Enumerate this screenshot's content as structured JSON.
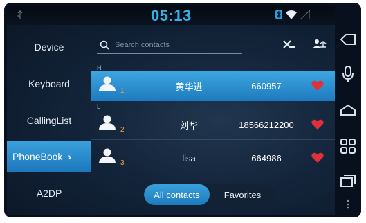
{
  "status": {
    "time": "05:13"
  },
  "sidebar": {
    "items": [
      {
        "label": "Device"
      },
      {
        "label": "Keyboard"
      },
      {
        "label": "CallingList"
      },
      {
        "label": "PhoneBook",
        "chevron": "›"
      },
      {
        "label": "A2DP"
      }
    ]
  },
  "search": {
    "placeholder": "Search contacts"
  },
  "contacts": [
    {
      "section": "H",
      "index": "1",
      "name": "黄华进",
      "phone": "660957"
    },
    {
      "section": "L",
      "index": "2",
      "name": "刘华",
      "phone": "18566212200"
    },
    {
      "section": "",
      "index": "3",
      "name": "lisa",
      "phone": "664986"
    }
  ],
  "tabs": {
    "all": "All contacts",
    "favorites": "Favorites"
  },
  "colors": {
    "accent": "#2a8fd0",
    "clock": "#36b0e8",
    "heart": "#e0303a",
    "index": "#f0a630"
  },
  "icons": [
    "search-icon",
    "clear-contacts-icon",
    "sync-contacts-icon",
    "avatar-icon",
    "heart-icon",
    "back-icon",
    "mic-icon",
    "home-icon",
    "apps-icon",
    "recents-icon",
    "bluetooth-icon",
    "wifi-icon",
    "signal-icon"
  ]
}
